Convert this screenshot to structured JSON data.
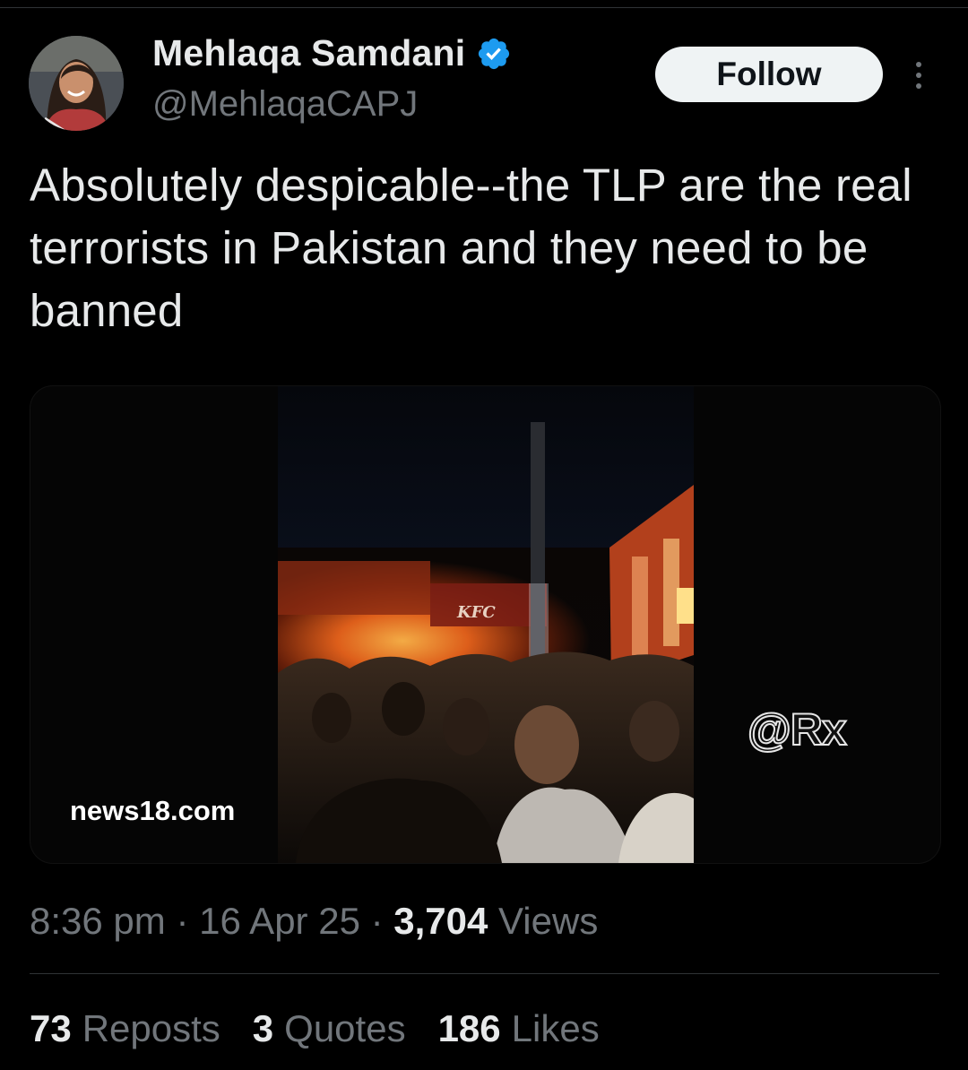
{
  "author": {
    "display_name": "Mehlaqa Samdani",
    "handle": "@MehlaqaCAPJ",
    "verified_icon": "verified-badge-icon",
    "badge_color": "#1d9bf0"
  },
  "header": {
    "follow_label": "Follow",
    "more_icon": "more-vertical-icon"
  },
  "tweet": {
    "text": "Absolutely despicable--the TLP are the real terrorists in Pakistan and they need to be banned"
  },
  "media": {
    "sign_text": "KFC",
    "watermark_left": "news18.com",
    "watermark_right": "@Rx"
  },
  "meta": {
    "time": "8:36 pm",
    "separator": "·",
    "date": "16 Apr 25",
    "views_count": "3,704",
    "views_label": "Views"
  },
  "stats": {
    "reposts": {
      "count": "73",
      "label": "Reposts"
    },
    "quotes": {
      "count": "3",
      "label": "Quotes"
    },
    "likes": {
      "count": "186",
      "label": "Likes"
    }
  },
  "colors": {
    "background": "#000000",
    "text_primary": "#e7e9ea",
    "text_secondary": "#71767b",
    "divider": "#2f3336",
    "button_bg": "#eff3f4"
  }
}
